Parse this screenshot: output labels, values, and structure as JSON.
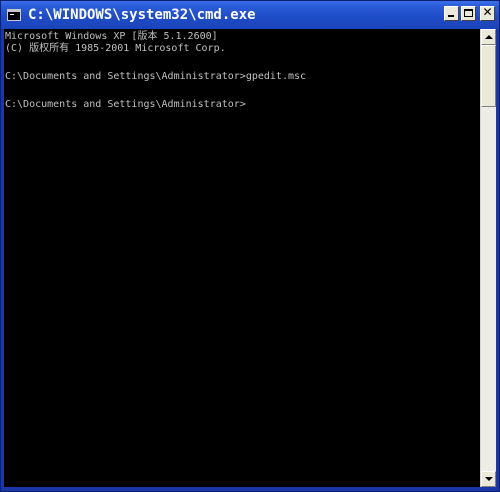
{
  "window": {
    "title": "C:\\WINDOWS\\system32\\cmd.exe",
    "icon": "cmd-icon",
    "controls": {
      "minimize": "minimize-icon",
      "maximize": "maximize-icon",
      "close_label": "✕"
    }
  },
  "console": {
    "lines": [
      "Microsoft Windows XP [版本 5.1.2600]",
      "(C) 版权所有 1985-2001 Microsoft Corp.",
      "",
      "C:\\Documents and Settings\\Administrator>gpedit.msc",
      "",
      "C:\\Documents and Settings\\Administrator>"
    ],
    "colors": {
      "background": "#000000",
      "text": "#c0c0c0"
    }
  },
  "scrollbar": {
    "up_icon": "arrow-up-icon",
    "down_icon": "arrow-down-icon"
  },
  "theme": {
    "titlebar_blue": "#1e4bc6",
    "frame_blue": "#1a37a8"
  }
}
